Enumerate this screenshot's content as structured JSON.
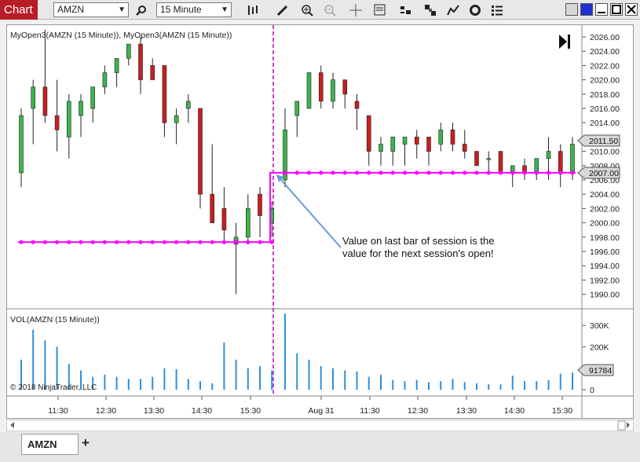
{
  "toolbar": {
    "chart_tab": "Chart",
    "instrument": "AMZN",
    "interval": "15 Minute"
  },
  "price_panel": {
    "indicator_label": "MyOpen3(AMZN (15 Minute)), MyOpen3(AMZN (15 Minute))",
    "price_ticks": [
      "2026.00",
      "2024.00",
      "2022.00",
      "2020.00",
      "2018.00",
      "2016.00",
      "2014.00",
      "2012.00",
      "2010.00",
      "2008.00",
      "2006.00",
      "2004.00",
      "2002.00",
      "2000.00",
      "1998.00",
      "1996.00",
      "1994.00",
      "1992.00",
      "1990.00"
    ],
    "last_price_marker": "2011.50",
    "indicator_marker": "2007.00",
    "annotation_line1": "Value on last bar of session is the",
    "annotation_line2": "value for the next session's open!"
  },
  "volume_panel": {
    "indicator_label": "VOL(AMZN (15 Minute))",
    "volume_ticks": [
      "300K",
      "200K",
      "100K",
      "0"
    ],
    "last_volume_marker": "91784",
    "copyright": "© 2018 NinjaTrader, LLC"
  },
  "time_axis": [
    "11:30",
    "12:30",
    "13:30",
    "14:30",
    "15:30",
    "Aug 31",
    "11:30",
    "12:30",
    "13:30",
    "14:30",
    "15:30"
  ],
  "bottom_tabs": {
    "symbol_tab": "AMZN",
    "add_tab": "+"
  },
  "colors": {
    "up": "#3cb44b",
    "down": "#c81e1e",
    "indicator": "#ff00ff",
    "volume": "#2f8fd8",
    "session_break": "#c000c0"
  },
  "chart_data": {
    "type": "candlestick",
    "instrument": "AMZN",
    "interval": "15 Minute",
    "ylim": [
      1989,
      2028
    ],
    "bars_day1": [
      {
        "o": 2007,
        "h": 2016,
        "l": 2005,
        "c": 2015
      },
      {
        "o": 2016,
        "h": 2020,
        "l": 2011,
        "c": 2019
      },
      {
        "o": 2019,
        "h": 2027,
        "l": 2014,
        "c": 2015
      },
      {
        "o": 2015,
        "h": 2020,
        "l": 2010,
        "c": 2013
      },
      {
        "o": 2012,
        "h": 2018,
        "l": 2009,
        "c": 2017
      },
      {
        "o": 2015,
        "h": 2018,
        "l": 2012,
        "c": 2017
      },
      {
        "o": 2016,
        "h": 2019,
        "l": 2014,
        "c": 2019
      },
      {
        "o": 2019,
        "h": 2022,
        "l": 2018,
        "c": 2021
      },
      {
        "o": 2021,
        "h": 2023,
        "l": 2019,
        "c": 2023
      },
      {
        "o": 2023,
        "h": 2025,
        "l": 2022,
        "c": 2025
      },
      {
        "o": 2025,
        "h": 2026,
        "l": 2018,
        "c": 2020
      },
      {
        "o": 2022,
        "h": 2023,
        "l": 2020,
        "c": 2020
      },
      {
        "o": 2022,
        "h": 2022,
        "l": 2012,
        "c": 2014
      },
      {
        "o": 2014,
        "h": 2016,
        "l": 2011,
        "c": 2015
      },
      {
        "o": 2016,
        "h": 2018,
        "l": 2014,
        "c": 2017
      },
      {
        "o": 2016,
        "h": 2016,
        "l": 2002,
        "c": 2004
      },
      {
        "o": 2004,
        "h": 2011,
        "l": 2001,
        "c": 2000
      },
      {
        "o": 2002,
        "h": 2005,
        "l": 1997,
        "c": 1999
      },
      {
        "o": 1997,
        "h": 2000,
        "l": 1990,
        "c": 1998
      },
      {
        "o": 1998,
        "h": 2004,
        "l": 1997,
        "c": 2002
      },
      {
        "o": 2004,
        "h": 2005,
        "l": 1998,
        "c": 2001
      },
      {
        "o": 2000,
        "h": 2003,
        "l": 1998,
        "c": 2002
      }
    ],
    "bars_day2": [
      {
        "o": 2006,
        "h": 2016,
        "l": 2005,
        "c": 2013
      },
      {
        "o": 2015,
        "h": 2016,
        "l": 2012,
        "c": 2017
      },
      {
        "o": 2016,
        "h": 2021,
        "l": 2016,
        "c": 2021
      },
      {
        "o": 2021,
        "h": 2022,
        "l": 2016,
        "c": 2017
      },
      {
        "o": 2017,
        "h": 2021,
        "l": 2016,
        "c": 2020
      },
      {
        "o": 2020,
        "h": 2020,
        "l": 2016,
        "c": 2018
      },
      {
        "o": 2017,
        "h": 2018,
        "l": 2013,
        "c": 2016
      },
      {
        "o": 2015,
        "h": 2015,
        "l": 2008,
        "c": 2010
      },
      {
        "o": 2010,
        "h": 2012,
        "l": 2008,
        "c": 2011
      },
      {
        "o": 2010,
        "h": 2012,
        "l": 2008,
        "c": 2012
      },
      {
        "o": 2011,
        "h": 2012,
        "l": 2008,
        "c": 2012
      },
      {
        "o": 2012,
        "h": 2013,
        "l": 2009,
        "c": 2011
      },
      {
        "o": 2012,
        "h": 2012,
        "l": 2008,
        "c": 2010
      },
      {
        "o": 2011,
        "h": 2014,
        "l": 2010,
        "c": 2013
      },
      {
        "o": 2013,
        "h": 2014,
        "l": 2010,
        "c": 2011
      },
      {
        "o": 2011,
        "h": 2013,
        "l": 2009,
        "c": 2010
      },
      {
        "o": 2010,
        "h": 2010,
        "l": 2008,
        "c": 2008
      },
      {
        "o": 2009,
        "h": 2010,
        "l": 2007,
        "c": 2009
      },
      {
        "o": 2010,
        "h": 2010,
        "l": 2007,
        "c": 2007
      },
      {
        "o": 2007,
        "h": 2008,
        "l": 2005,
        "c": 2008
      },
      {
        "o": 2008,
        "h": 2009,
        "l": 2006,
        "c": 2007
      },
      {
        "o": 2007,
        "h": 2009,
        "l": 2006,
        "c": 2009
      },
      {
        "o": 2009,
        "h": 2012,
        "l": 2006,
        "c": 2010
      },
      {
        "o": 2010,
        "h": 2011,
        "l": 2005,
        "c": 2007
      },
      {
        "o": 2007,
        "h": 2012,
        "l": 2006,
        "c": 2011
      }
    ],
    "volume_day1": [
      140,
      280,
      230,
      200,
      120,
      90,
      60,
      70,
      60,
      50,
      50,
      60,
      100,
      95,
      50,
      40,
      30,
      220,
      140,
      100,
      110,
      90
    ],
    "volume_day2": [
      355,
      170,
      140,
      110,
      100,
      90,
      85,
      60,
      70,
      45,
      40,
      45,
      35,
      40,
      50,
      35,
      30,
      25,
      25,
      65,
      40,
      40,
      45,
      75,
      80
    ],
    "indicator_day1_value": 1997.3,
    "indicator_day2_value": 2007.0
  }
}
